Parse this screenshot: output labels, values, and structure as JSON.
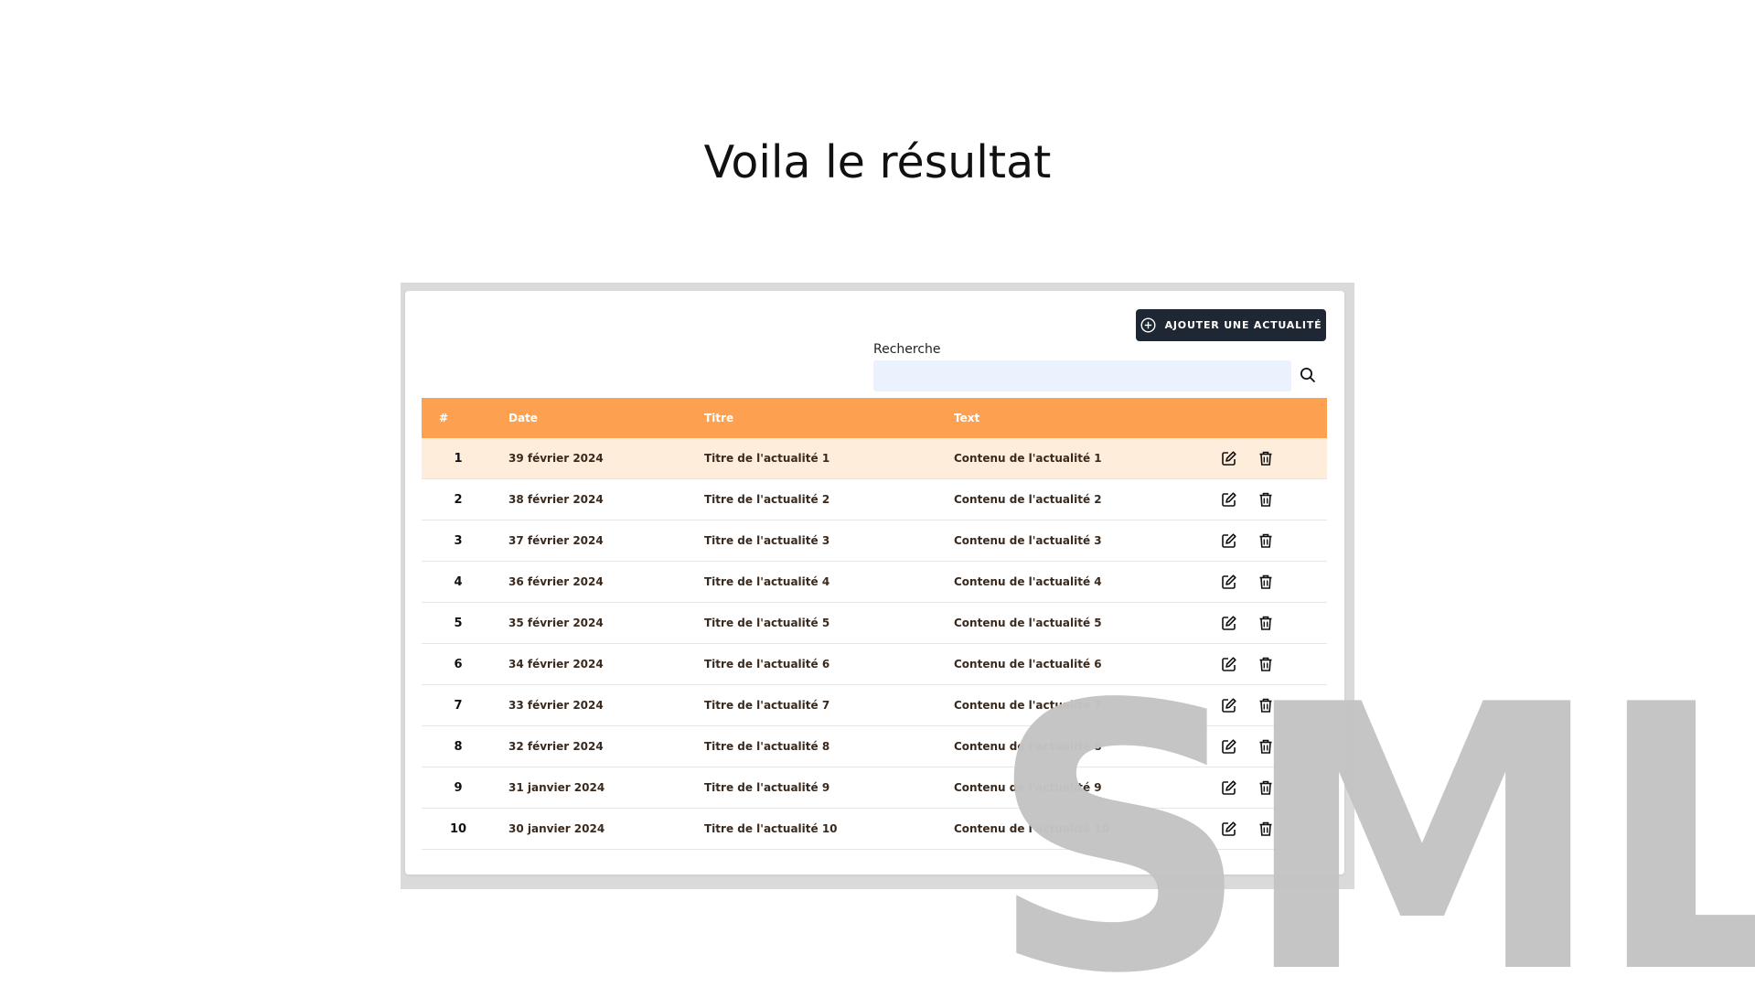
{
  "slide": {
    "title": "Voila le résultat",
    "watermark": "SML"
  },
  "toolbar": {
    "add_label": "AJOUTER UNE ACTUALITÉ"
  },
  "search": {
    "label": "Recherche",
    "value": "",
    "placeholder": ""
  },
  "table": {
    "headers": {
      "num": "#",
      "date": "Date",
      "title": "Titre",
      "text": "Text"
    },
    "rows": [
      {
        "num": "1",
        "date": "39 février 2024",
        "title": "Titre de l'actualité 1",
        "text": "Contenu de l'actualité 1"
      },
      {
        "num": "2",
        "date": "38 février 2024",
        "title": "Titre de l'actualité 2",
        "text": "Contenu de l'actualité 2"
      },
      {
        "num": "3",
        "date": "37 février 2024",
        "title": "Titre de l'actualité 3",
        "text": "Contenu de l'actualité 3"
      },
      {
        "num": "4",
        "date": "36 février 2024",
        "title": "Titre de l'actualité 4",
        "text": "Contenu de l'actualité 4"
      },
      {
        "num": "5",
        "date": "35 février 2024",
        "title": "Titre de l'actualité 5",
        "text": "Contenu de l'actualité 5"
      },
      {
        "num": "6",
        "date": "34 février 2024",
        "title": "Titre de l'actualité 6",
        "text": "Contenu de l'actualité 6"
      },
      {
        "num": "7",
        "date": "33 février 2024",
        "title": "Titre de l'actualité 7",
        "text": "Contenu de l'actualité 7"
      },
      {
        "num": "8",
        "date": "32 février 2024",
        "title": "Titre de l'actualité 8",
        "text": "Contenu de l'actualité 8"
      },
      {
        "num": "9",
        "date": "31 janvier 2024",
        "title": "Titre de l'actualité 9",
        "text": "Contenu de l'actualité 9"
      },
      {
        "num": "10",
        "date": "30 janvier 2024",
        "title": "Titre de l'actualité 10",
        "text": "Contenu de l'actualité 10"
      }
    ]
  },
  "icons": {
    "add": "plus-circle-icon",
    "search": "search-icon",
    "edit": "edit-icon",
    "delete": "trash-icon"
  },
  "colors": {
    "header_bg": "#fda150",
    "highlight_row": "#ffeddc",
    "button_bg": "#1e2733",
    "search_bg": "#eaf2fd",
    "watermark": "#c4c4c4"
  }
}
